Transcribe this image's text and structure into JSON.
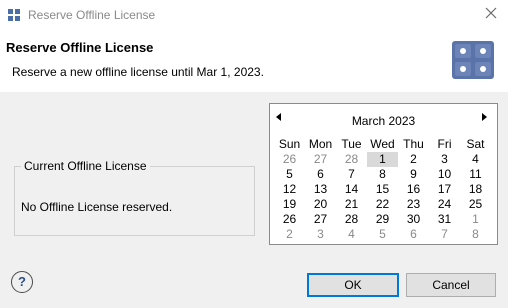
{
  "window": {
    "title": "Reserve Offline License"
  },
  "header": {
    "title": "Reserve Offline License",
    "subtitle": "Reserve a new offline license until Mar 1, 2023."
  },
  "current_license": {
    "label": "Current Offline License",
    "status": "No Offline License reserved."
  },
  "calendar": {
    "month_label": "March 2023",
    "weekdays": [
      "Sun",
      "Mon",
      "Tue",
      "Wed",
      "Thu",
      "Fri",
      "Sat"
    ],
    "days": [
      {
        "d": "26",
        "dim": true
      },
      {
        "d": "27",
        "dim": true
      },
      {
        "d": "28",
        "dim": true
      },
      {
        "d": "1",
        "sel": true
      },
      {
        "d": "2"
      },
      {
        "d": "3"
      },
      {
        "d": "4"
      },
      {
        "d": "5"
      },
      {
        "d": "6"
      },
      {
        "d": "7"
      },
      {
        "d": "8"
      },
      {
        "d": "9"
      },
      {
        "d": "10"
      },
      {
        "d": "11"
      },
      {
        "d": "12"
      },
      {
        "d": "13"
      },
      {
        "d": "14"
      },
      {
        "d": "15"
      },
      {
        "d": "16"
      },
      {
        "d": "17"
      },
      {
        "d": "18"
      },
      {
        "d": "19"
      },
      {
        "d": "20"
      },
      {
        "d": "21"
      },
      {
        "d": "22"
      },
      {
        "d": "23"
      },
      {
        "d": "24"
      },
      {
        "d": "25"
      },
      {
        "d": "26"
      },
      {
        "d": "27"
      },
      {
        "d": "28"
      },
      {
        "d": "29"
      },
      {
        "d": "30"
      },
      {
        "d": "31"
      },
      {
        "d": "1",
        "dim": true
      },
      {
        "d": "2",
        "dim": true
      },
      {
        "d": "3",
        "dim": true
      },
      {
        "d": "4",
        "dim": true
      },
      {
        "d": "5",
        "dim": true
      },
      {
        "d": "6",
        "dim": true
      },
      {
        "d": "7",
        "dim": true
      },
      {
        "d": "8",
        "dim": true
      }
    ]
  },
  "buttons": {
    "ok": "OK",
    "cancel": "Cancel",
    "help": "?"
  },
  "icons": {
    "app": "app-grid-icon",
    "close": "close-icon",
    "badge": "license-badge-icon",
    "help": "help-icon"
  }
}
